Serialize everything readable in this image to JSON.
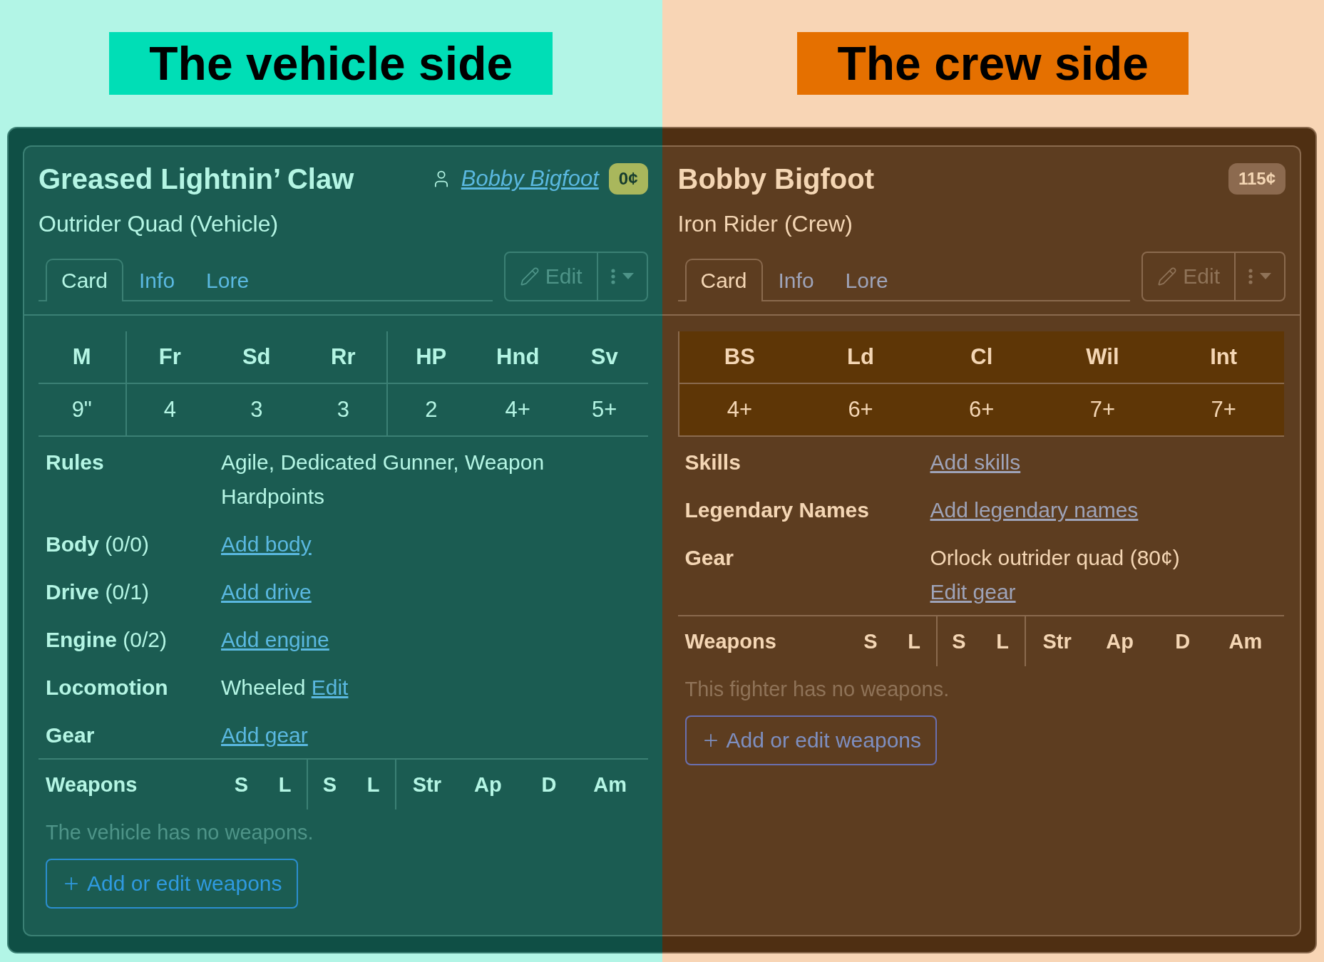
{
  "sides": [
    {
      "kind": "vehicle",
      "banner": {
        "label": "The vehicle side",
        "color": "#00deb6"
      },
      "card": {
        "title": "Greased Lightnin’ Claw",
        "owner": "Bobby Bigfoot",
        "cost": "0¢",
        "subtitle": "Outrider Quad (Vehicle)",
        "tabs": [
          {
            "label": "Card",
            "selected": true
          },
          {
            "label": "Info",
            "selected": false
          },
          {
            "label": "Lore",
            "selected": false
          }
        ],
        "edit_label": "Edit",
        "stat_groups": [
          [
            {
              "label": "M",
              "value": "9\""
            }
          ],
          [
            {
              "label": "Fr",
              "value": "4"
            },
            {
              "label": "Sd",
              "value": "3"
            },
            {
              "label": "Rr",
              "value": "3"
            }
          ],
          [
            {
              "label": "HP",
              "value": "2"
            },
            {
              "label": "Hnd",
              "value": "4+"
            },
            {
              "label": "Sv",
              "value": "5+"
            }
          ]
        ],
        "rows": [
          {
            "label": "Rules",
            "lines": [
              [
                {
                  "text": "Agile, Dedicated Gunner, Weapon Hardpoints",
                  "link": false
                }
              ]
            ]
          },
          {
            "label": "Body",
            "count": "(0/0)",
            "lines": [
              [
                {
                  "text": "Add body",
                  "link": true
                }
              ]
            ]
          },
          {
            "label": "Drive",
            "count": "(0/1)",
            "lines": [
              [
                {
                  "text": "Add drive",
                  "link": true
                }
              ]
            ]
          },
          {
            "label": "Engine",
            "count": "(0/2)",
            "lines": [
              [
                {
                  "text": "Add engine",
                  "link": true
                }
              ]
            ]
          },
          {
            "label": "Locomotion",
            "lines": [
              [
                {
                  "text": "Wheeled",
                  "link": false
                },
                {
                  "text": "Edit",
                  "link": true
                }
              ]
            ]
          },
          {
            "label": "Gear",
            "lines": [
              [
                {
                  "text": "Add gear",
                  "link": true
                }
              ]
            ]
          }
        ],
        "weapons": {
          "title": "Weapons",
          "groups": [
            [
              "S",
              "L"
            ],
            [
              "S",
              "L"
            ],
            [
              "Str",
              "Ap",
              "D",
              "Am"
            ]
          ],
          "empty": "The vehicle has no weapons.",
          "add_label": "Add or edit weapons"
        }
      }
    },
    {
      "kind": "crew",
      "banner": {
        "label": "The crew side",
        "color": "#e57000"
      },
      "card": {
        "title": "Bobby Bigfoot",
        "cost": "115¢",
        "subtitle": "Iron Rider (Crew)",
        "tabs": [
          {
            "label": "Card",
            "selected": true
          },
          {
            "label": "Info",
            "selected": false
          },
          {
            "label": "Lore",
            "selected": false
          }
        ],
        "edit_label": "Edit",
        "stat_groups": [
          [
            {
              "label": "BS",
              "value": "4+"
            },
            {
              "label": "Ld",
              "value": "6+"
            },
            {
              "label": "Cl",
              "value": "6+"
            },
            {
              "label": "Wil",
              "value": "7+"
            },
            {
              "label": "Int",
              "value": "7+"
            }
          ]
        ],
        "rows": [
          {
            "label": "Skills",
            "lines": [
              [
                {
                  "text": "Add skills",
                  "link": true
                }
              ]
            ]
          },
          {
            "label": "Legendary Names",
            "lines": [
              [
                {
                  "text": "Add legendary names",
                  "link": true
                }
              ]
            ]
          },
          {
            "label": "Gear",
            "lines": [
              [
                {
                  "text": "Orlock outrider quad (80¢)",
                  "link": false
                }
              ],
              [
                {
                  "text": "Edit gear",
                  "link": true
                }
              ]
            ]
          }
        ],
        "weapons": {
          "title": "Weapons",
          "groups": [
            [
              "S",
              "L"
            ],
            [
              "S",
              "L"
            ],
            [
              "Str",
              "Ap",
              "D",
              "Am"
            ]
          ],
          "empty": "This fighter has no weapons.",
          "add_label": "Add or edit weapons"
        }
      }
    }
  ]
}
